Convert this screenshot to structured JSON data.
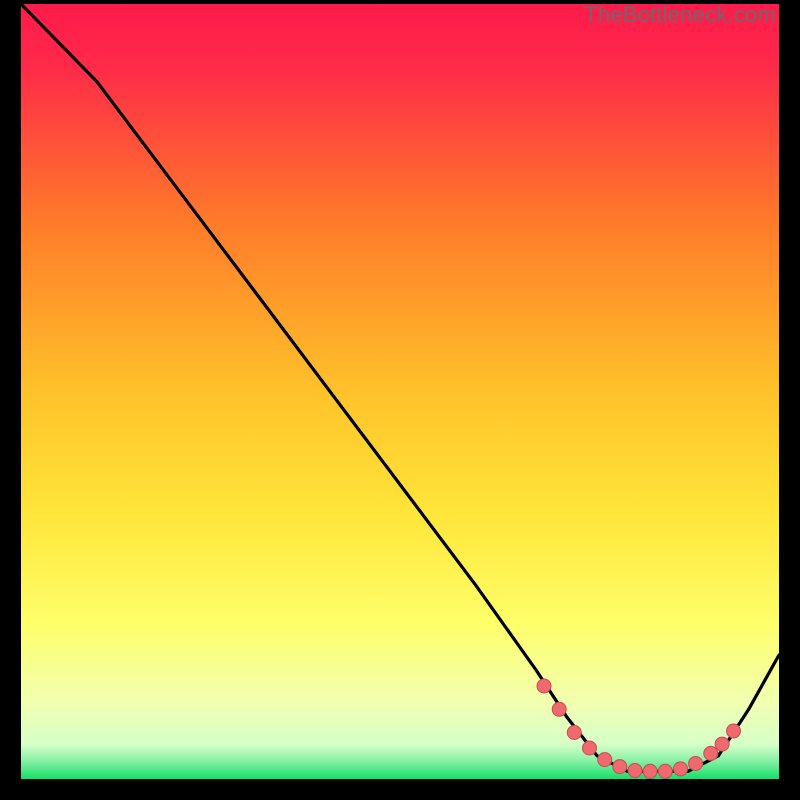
{
  "watermark": "TheBottleneck.com",
  "colors": {
    "gradient_top": "#ff1a4b",
    "gradient_mid1": "#ff7a2a",
    "gradient_mid2": "#ffe63a",
    "gradient_low": "#f7ffba",
    "gradient_bottom": "#15e06a",
    "curve": "#000000",
    "dot_fill": "#ef6a6f",
    "dot_stroke": "#c94a50"
  },
  "chart_data": {
    "type": "line",
    "title": "",
    "xlabel": "",
    "ylabel": "",
    "xlim": [
      0,
      100
    ],
    "ylim": [
      0,
      100
    ],
    "series": [
      {
        "name": "bottleneck-curve",
        "x": [
          0,
          8,
          10,
          20,
          30,
          40,
          50,
          60,
          68,
          72,
          76,
          80,
          84,
          88,
          92,
          96,
          100
        ],
        "y": [
          100,
          92,
          90,
          77,
          64,
          51,
          38,
          25,
          14,
          8,
          3,
          1,
          1,
          1,
          3,
          9,
          16
        ]
      }
    ],
    "highlight_dots": {
      "name": "low-bottleneck-range",
      "x": [
        69,
        71,
        73,
        75,
        77,
        79,
        81,
        83,
        85,
        87,
        89,
        91,
        92.5,
        94
      ],
      "y": [
        12,
        9,
        6,
        4,
        2.5,
        1.6,
        1.1,
        1,
        1,
        1.3,
        2,
        3.3,
        4.5,
        6.2
      ]
    }
  }
}
